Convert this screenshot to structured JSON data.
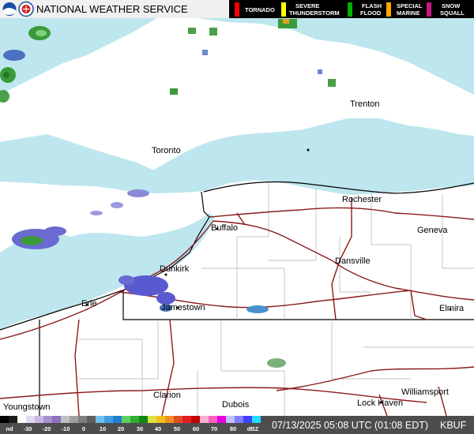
{
  "header": {
    "agency": "NATIONAL WEATHER SERVICE",
    "warnings": [
      {
        "line1": "TORNADO",
        "line2": "",
        "color": "#ff0000"
      },
      {
        "line1": "SEVERE",
        "line2": "THUNDERSTORM",
        "color": "#ffff00"
      },
      {
        "line1": "FLASH",
        "line2": "FLOOD",
        "color": "#00b000"
      },
      {
        "line1": "SPECIAL",
        "line2": "MARINE",
        "color": "#ffa500"
      },
      {
        "line1": "SNOW",
        "line2": "SQUALL",
        "color": "#c71585"
      }
    ]
  },
  "cities": {
    "trenton": "Trenton",
    "toronto": "Toronto",
    "rochester": "Rochester",
    "geneva": "Geneva",
    "buffalo": "Buffalo",
    "dansville": "Dansville",
    "dunkirk": "Dunkirk",
    "erie": "Erie",
    "jamestown": "Jamestown",
    "elmira": "Elmira",
    "clarion": "Clarion",
    "williamsport": "Williamsport",
    "youngstown": "Youngstown",
    "dubois": "Dubois",
    "lock_haven": "Lock Haven"
  },
  "scale": {
    "labels": [
      "nd",
      "-30",
      "-20",
      "-10",
      "0",
      "10",
      "20",
      "30",
      "40",
      "50",
      "60",
      "70",
      "80",
      "dBZ"
    ]
  },
  "footer": {
    "timestamp": "07/13/2025 05:08 UTC (01:08 EDT)",
    "station": "KBUF"
  },
  "colors": {
    "water": "#bde6ee",
    "land": "#ffffff",
    "interstate": "#8b1a1a",
    "border": "#000000"
  }
}
